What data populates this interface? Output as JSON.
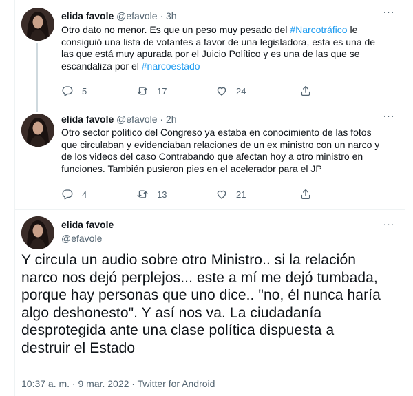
{
  "tweets": [
    {
      "name": "elida favole",
      "handle": "@efavole",
      "time": "3h",
      "text_parts": [
        "Otro dato no menor. Es que un peso muy pesado del ",
        "#Narcotráfico",
        " le\nconsiguió una lista de votantes a favor de una legisladora, esta es una de\nlas que está muy apurada por el Juicio Político y es una de las que se\nescandaliza por el ",
        "#narcoestado",
        ""
      ],
      "replies": "5",
      "retweets": "17",
      "likes": "24"
    },
    {
      "name": "elida favole",
      "handle": "@efavole",
      "time": "2h",
      "text": "Otro sector político del Congreso ya estaba en conocimiento de las fotos\nque circulaban y evidenciaban relaciones de un ex ministro con un narco y\nde los videos del caso Contrabando que afectan hoy a otro ministro en\nfunciones. También pusieron pies en el acelerador para el JP",
      "replies": "4",
      "retweets": "13",
      "likes": "21"
    }
  ],
  "main_tweet": {
    "name": "elida favole",
    "handle": "@efavole",
    "text": "Y circula un audio sobre otro Ministro.. si la relación\nnarco nos dejó perplejos... este a mí me dejó tumbada,\nporque hay personas que uno dice.. \"no, él nunca haría\nalgo deshonesto\". Y así nos va. La ciudadanía\ndesprotegida ante una clase política dispuesta a\ndestruir el Estado",
    "timestamp": "10:37 a. m. · 9 mar. 2022 · Twitter for Android"
  },
  "ui": {
    "separator": "·",
    "more_glyph": "···"
  },
  "icons": {
    "reply": "reply-icon",
    "retweet": "retweet-icon",
    "like": "heart-icon",
    "share": "share-icon",
    "more": "more-icon"
  },
  "colors": {
    "link": "#1d9bf0",
    "secondary": "#536471",
    "text": "#0f1419",
    "thread_line": "#cfd9de"
  }
}
